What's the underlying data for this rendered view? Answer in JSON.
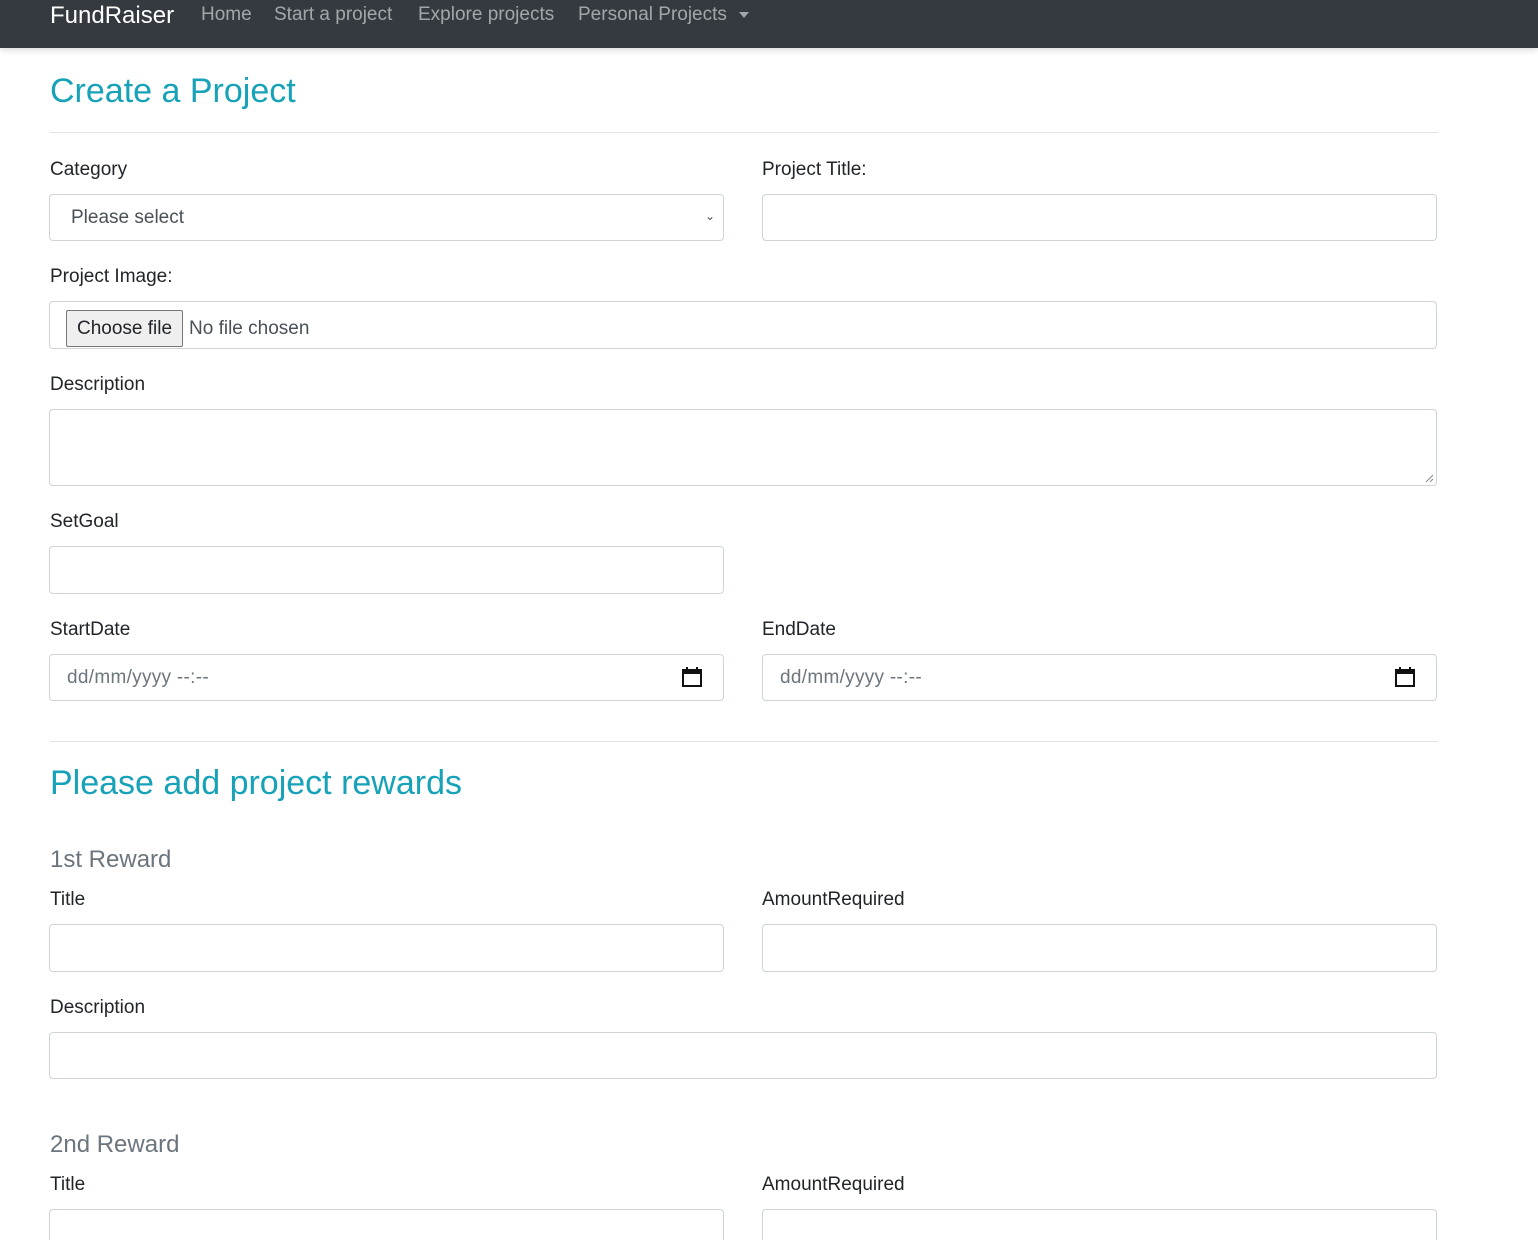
{
  "navbar": {
    "brand": "FundRaiser",
    "links": [
      "Home",
      "Start a project",
      "Explore projects",
      "Personal Projects"
    ]
  },
  "project": {
    "heading": "Create a Project",
    "category_label": "Category",
    "category_selected": "Please select",
    "title_label": "Project Title:",
    "image_label": "Project Image:",
    "file_button": "Choose file",
    "file_status": "No file chosen",
    "description_label": "Description",
    "goal_label": "SetGoal",
    "start_label": "StartDate",
    "end_label": "EndDate",
    "date_placeholder": "dd/mm/yyyy  --:--"
  },
  "rewards": {
    "heading": "Please add project rewards",
    "items": [
      {
        "heading": "1st Reward",
        "title_label": "Title",
        "amount_label": "AmountRequired",
        "description_label": "Description"
      },
      {
        "heading": "2nd Reward",
        "title_label": "Title",
        "amount_label": "AmountRequired"
      }
    ]
  }
}
